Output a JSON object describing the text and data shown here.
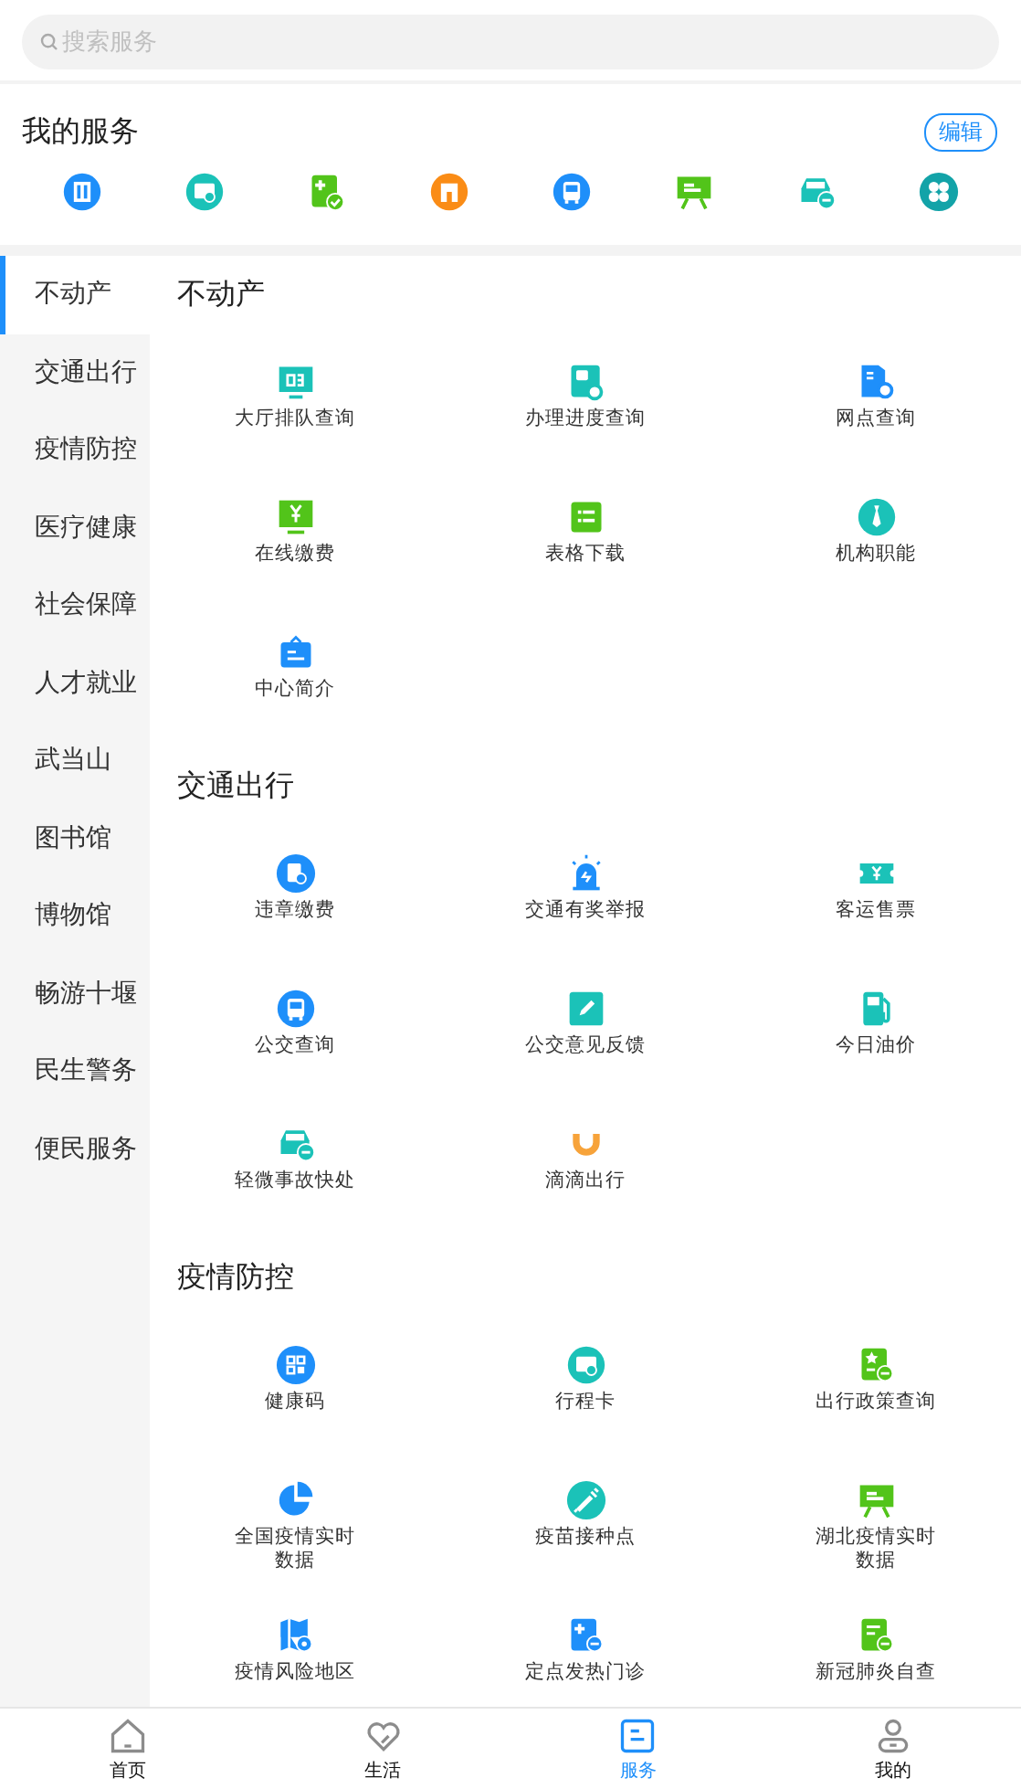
{
  "search": {
    "placeholder": "搜索服务"
  },
  "my_services": {
    "title": "我的服务",
    "edit_button": "编辑",
    "icons": [
      {
        "kind": "building"
      },
      {
        "kind": "card"
      },
      {
        "kind": "medical-check"
      },
      {
        "kind": "shirt"
      },
      {
        "kind": "bus"
      },
      {
        "kind": "board"
      },
      {
        "kind": "car"
      },
      {
        "kind": "apps"
      }
    ]
  },
  "sidebar": {
    "items": [
      {
        "label": "不动产",
        "selected": true
      },
      {
        "label": "交通出行",
        "selected": false
      },
      {
        "label": "疫情防控",
        "selected": false
      },
      {
        "label": "医疗健康",
        "selected": false
      },
      {
        "label": "社会保障",
        "selected": false
      },
      {
        "label": "人才就业",
        "selected": false
      },
      {
        "label": "武当山",
        "selected": false
      },
      {
        "label": "图书馆",
        "selected": false
      },
      {
        "label": "博物馆",
        "selected": false
      },
      {
        "label": "畅游十堰",
        "selected": false
      },
      {
        "label": "民生警务",
        "selected": false
      },
      {
        "label": "便民服务",
        "selected": false
      }
    ]
  },
  "sections": [
    {
      "title": "不动产",
      "items": [
        {
          "kind": "monitor-number",
          "label": "大厅排队查询"
        },
        {
          "kind": "doc-search",
          "label": "办理进度查询"
        },
        {
          "kind": "folder-search",
          "label": "网点查询"
        },
        {
          "kind": "yen-monitor",
          "label": "在线缴费"
        },
        {
          "kind": "list",
          "label": "表格下载"
        },
        {
          "kind": "tie",
          "label": "机构职能"
        },
        {
          "kind": "bag",
          "label": "中心简介"
        }
      ]
    },
    {
      "title": "交通出行",
      "items": [
        {
          "kind": "doc-circle",
          "label": "违章缴费"
        },
        {
          "kind": "siren",
          "label": "交通有奖举报"
        },
        {
          "kind": "ticket",
          "label": "客运售票"
        },
        {
          "kind": "bus",
          "label": "公交查询"
        },
        {
          "kind": "pen",
          "label": "公交意见反馈"
        },
        {
          "kind": "fuel",
          "label": "今日油价"
        },
        {
          "kind": "car",
          "label": "轻微事故快处"
        },
        {
          "kind": "arc",
          "label": "滴滴出行"
        }
      ]
    },
    {
      "title": "疫情防控",
      "items": [
        {
          "kind": "qr",
          "label": "健康码"
        },
        {
          "kind": "card",
          "label": "行程卡"
        },
        {
          "kind": "star-doc",
          "label": "出行政策查询"
        },
        {
          "kind": "pie",
          "label": "全国疫情实时数据"
        },
        {
          "kind": "syringe",
          "label": "疫苗接种点"
        },
        {
          "kind": "board",
          "label": "湖北疫情实时数据"
        },
        {
          "kind": "map",
          "label": "疫情风险地区"
        },
        {
          "kind": "medical-doc",
          "label": "定点发热门诊"
        },
        {
          "kind": "green-doc",
          "label": "新冠肺炎自查"
        }
      ]
    }
  ],
  "tab_bar": [
    {
      "kind": "home",
      "label": "首页",
      "selected": false
    },
    {
      "kind": "heart",
      "label": "生活",
      "selected": false
    },
    {
      "kind": "service",
      "label": "服务",
      "selected": true
    },
    {
      "kind": "person",
      "label": "我的",
      "selected": false
    }
  ]
}
